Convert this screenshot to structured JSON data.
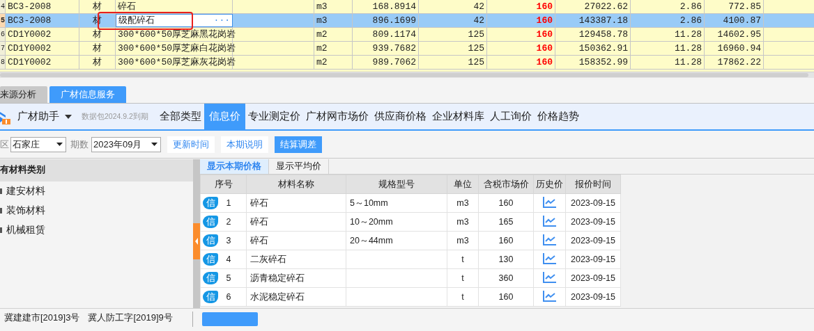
{
  "grid": {
    "ellipsis_button": "···",
    "rows": [
      {
        "row_number": "4",
        "selected": false,
        "editing": false,
        "highlighted": false,
        "cells": [
          "BC3-2008",
          "材",
          "碎石",
          "m3",
          "168.8914",
          "42",
          "160",
          "27022.62",
          "2.86",
          "772.85"
        ]
      },
      {
        "row_number": "5",
        "selected": true,
        "editing": true,
        "highlighted": true,
        "cells": [
          "BC3-2008",
          "材",
          "级配碎石",
          "m3",
          "896.1699",
          "42",
          "160",
          "143387.18",
          "2.86",
          "4100.87"
        ]
      },
      {
        "row_number": "6",
        "selected": false,
        "editing": false,
        "highlighted": false,
        "cells": [
          "CD1Y0002",
          "材",
          "300*600*50厚芝麻黑花岗岩",
          "m2",
          "809.1174",
          "125",
          "160",
          "129458.78",
          "11.28",
          "14602.95"
        ]
      },
      {
        "row_number": "7",
        "selected": false,
        "editing": false,
        "highlighted": false,
        "cells": [
          "CD1Y0002",
          "材",
          "300*600*50厚芝麻白花岗岩",
          "m2",
          "939.7682",
          "125",
          "160",
          "150362.91",
          "11.28",
          "16960.94"
        ]
      },
      {
        "row_number": "8",
        "selected": false,
        "editing": false,
        "highlighted": false,
        "cells": [
          "CD1Y0002",
          "材",
          "300*600*50厚芝麻灰花岗岩",
          "m2",
          "989.7062",
          "125",
          "160",
          "158352.99",
          "11.28",
          "17862.22"
        ]
      }
    ]
  },
  "bottom_tabs": [
    {
      "label": "来源分析",
      "selected": false
    },
    {
      "label": "广材信息服务",
      "selected": true
    }
  ],
  "toolbar": {
    "brand": "广材助手",
    "expiry": "数据包2024.9.2到期",
    "nav": [
      {
        "label": "全部类型",
        "selected": false
      },
      {
        "label": "信息价",
        "selected": true
      },
      {
        "label": "专业测定价",
        "selected": false
      },
      {
        "label": "广材网市场价",
        "selected": false
      },
      {
        "label": "供应商价格",
        "selected": false
      },
      {
        "label": "企业材料库",
        "selected": false
      },
      {
        "label": "人工询价",
        "selected": false
      },
      {
        "label": "价格趋势",
        "selected": false
      }
    ]
  },
  "filter": {
    "region_label": "区",
    "region": "石家庄",
    "period_label": "期数",
    "period": "2023年09月",
    "buttons": [
      {
        "label": "更新时间",
        "kind": "link"
      },
      {
        "label": "本期说明",
        "kind": "link"
      },
      {
        "label": "结算调差",
        "kind": "primary"
      }
    ]
  },
  "categories": {
    "header": "有材料类别",
    "items": [
      "建安材料",
      "装饰材料",
      "机械租赁"
    ]
  },
  "price_tabs": [
    {
      "label": "显示本期价格",
      "selected": true
    },
    {
      "label": "显示平均价",
      "selected": false
    }
  ],
  "table": {
    "columns": [
      "序号",
      "材料名称",
      "规格型号",
      "单位",
      "含税市场价",
      "历史价",
      "报价时间"
    ],
    "rows": [
      {
        "badge": "信",
        "number": "1",
        "name": "碎石",
        "spec": "5～10mm",
        "unit": "m3",
        "price": "160",
        "date": "2023-09-15"
      },
      {
        "badge": "信",
        "number": "2",
        "name": "碎石",
        "spec": "10～20mm",
        "unit": "m3",
        "price": "165",
        "date": "2023-09-15"
      },
      {
        "badge": "信",
        "number": "3",
        "name": "碎石",
        "spec": "20～44mm",
        "unit": "m3",
        "price": "160",
        "date": "2023-09-15"
      },
      {
        "badge": "信",
        "number": "4",
        "name": "二灰碎石",
        "unit": "t",
        "price": "130",
        "date": "2023-09-15"
      },
      {
        "badge": "信",
        "number": "5",
        "name": "沥青稳定碎石",
        "unit": "t",
        "price": "360",
        "date": "2023-09-15"
      },
      {
        "badge": "信",
        "number": "6",
        "name": "水泥稳定碎石",
        "unit": "t",
        "price": "160",
        "date": "2023-09-15"
      }
    ]
  },
  "status_texts": [
    "冀建建市[2019]3号",
    "冀人防工字[2019]9号"
  ]
}
